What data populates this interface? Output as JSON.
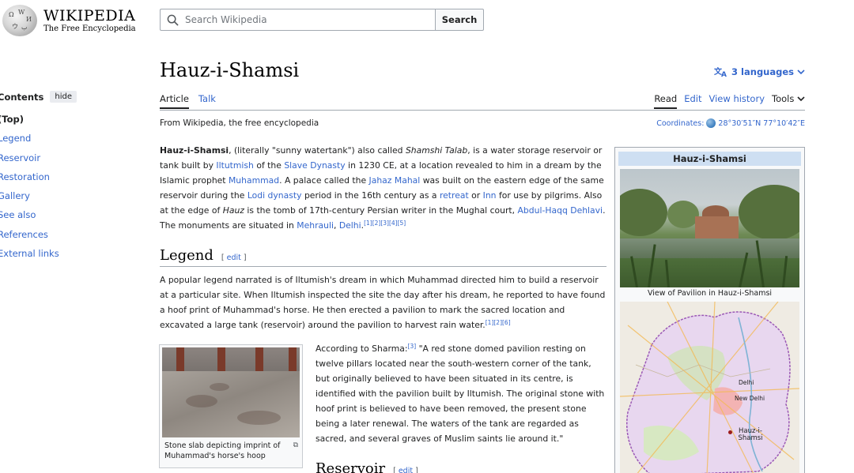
{
  "logo": {
    "title": "WIKIPEDIA",
    "subtitle": "The Free Encyclopedia"
  },
  "search": {
    "placeholder": "Search Wikipedia",
    "button": "Search"
  },
  "toc": {
    "title": "Contents",
    "hide": "hide",
    "items": [
      "(Top)",
      "Legend",
      "Reservoir",
      "Restoration",
      "Gallery",
      "See also",
      "References",
      "External links"
    ]
  },
  "article": {
    "title": "Hauz-i-Shamsi",
    "languages": "3 languages",
    "tabs_left": [
      "Article",
      "Talk"
    ],
    "tabs_right": [
      "Read",
      "Edit",
      "View history",
      "Tools"
    ],
    "tagline": "From Wikipedia, the free encyclopedia",
    "coordinates_label": "Coordinates:",
    "coordinates_value": "28°30′51″N 77°10′42″E"
  },
  "lead": {
    "t1": "Hauz-i-Shamsi",
    "t2": ", (literally \"sunny watertank\") also called ",
    "t3": "Shamshi Talab",
    "t4": ", is a water storage reservoir or tank built by ",
    "l1": "Iltutmish",
    "t5": " of the ",
    "l2": "Slave Dynasty",
    "t6": " in 1230 CE, at a location revealed to him in a dream by the Islamic prophet ",
    "l3": "Muhammad",
    "t7": ". A palace called the ",
    "l4": "Jahaz Mahal",
    "t8": " was built on the eastern edge of the same reservoir during the ",
    "l5": "Lodi dynasty",
    "t9": " period in the 16th century as a ",
    "l6": "retreat",
    "t10": " or ",
    "l7": "Inn",
    "t11": " for use by pilgrims. Also at the edge of ",
    "t12": "Hauz",
    "t13": " is the tomb of 17th-century Persian writer in the Mughal court, ",
    "l8": "Abdul-Haqq Dehlavi",
    "t14": ". The monuments are situated in ",
    "l9": "Mehrauli",
    "t15": ", ",
    "l10": "Delhi",
    "t16": ".",
    "refs": "[1][2][3][4][5]"
  },
  "legend_section": {
    "heading": "Legend",
    "edit": "edit",
    "text": "A popular legend narrated is of Iltumish's dream in which Muhammad directed him to build a reservoir at a particular site. When Iltumish inspected the site the day after his dream, he reported to have found a hoof print of Muhammad's horse. He then erected a pavilion to mark the sacred location and excavated a large tank (reservoir) around the pavilion to harvest rain water.",
    "refs": "[1][2][6]"
  },
  "slab_figure": {
    "caption": "Stone slab depicting imprint of Muhammad's horse's hoop"
  },
  "sharma": {
    "prefix": "According to Sharma:",
    "ref": "[3]",
    "text": " \"A red stone domed pavilion resting on twelve pillars located near the south-western corner of the tank, but originally believed to have been situated in its centre, is identified with the pavilion built by Iltumish. The original stone with hoof print is believed to have been removed, the present stone being a later renewal. The waters of the tank are regarded as sacred, and several graves of Muslim saints lie around it.\""
  },
  "reservoir_section": {
    "heading": "Reservoir",
    "edit": "edit"
  },
  "infobox": {
    "title": "Hauz-i-Shamsi",
    "photo_caption": "View of Pavilion in Hauz-i-Shamsi",
    "map_labels": {
      "delhi": "Delhi",
      "new_delhi": "New Delhi",
      "marker": "Hauz-i-Shamsi"
    }
  },
  "colors": {
    "link": "#3366cc",
    "infobox_header": "#cedff2",
    "border": "#a2a9b1"
  },
  "icons": [
    "wikipedia-globe-icon",
    "search-icon",
    "translate-icon",
    "chevron-down-icon",
    "globe-icon",
    "enlarge-icon"
  ]
}
